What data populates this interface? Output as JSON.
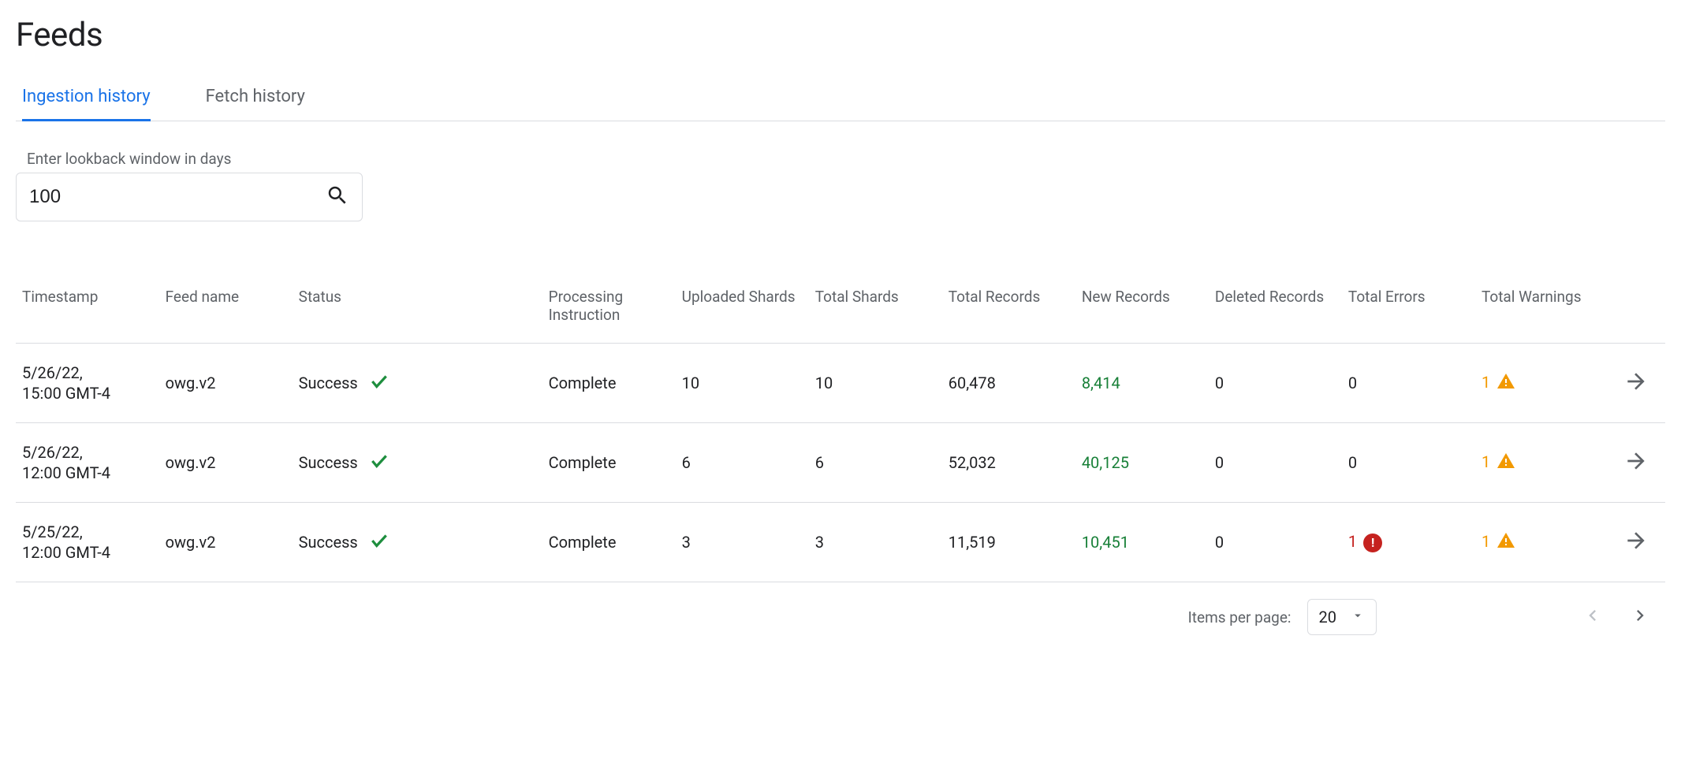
{
  "page_title": "Feeds",
  "tabs": [
    {
      "label": "Ingestion history",
      "active": true
    },
    {
      "label": "Fetch history",
      "active": false
    }
  ],
  "filter": {
    "label": "Enter lookback window in days",
    "value": "100"
  },
  "columns": {
    "timestamp": "Timestamp",
    "feed_name": "Feed name",
    "status": "Status",
    "processing_instruction": "Processing Instruction",
    "uploaded_shards": "Uploaded Shards",
    "total_shards": "Total Shards",
    "total_records": "Total Records",
    "new_records": "New Records",
    "deleted_records": "Deleted Records",
    "total_errors": "Total Errors",
    "total_warnings": "Total Warnings"
  },
  "rows": [
    {
      "timestamp_line1": "5/26/22,",
      "timestamp_line2": "15:00 GMT-4",
      "feed_name": "owg.v2",
      "status": "Success",
      "processing_instruction": "Complete",
      "uploaded_shards": "10",
      "total_shards": "10",
      "total_records": "60,478",
      "new_records": "8,414",
      "deleted_records": "0",
      "total_errors": "0",
      "total_errors_flag": false,
      "total_warnings": "1",
      "total_warnings_flag": true
    },
    {
      "timestamp_line1": "5/26/22,",
      "timestamp_line2": "12:00 GMT-4",
      "feed_name": "owg.v2",
      "status": "Success",
      "processing_instruction": "Complete",
      "uploaded_shards": "6",
      "total_shards": "6",
      "total_records": "52,032",
      "new_records": "40,125",
      "deleted_records": "0",
      "total_errors": "0",
      "total_errors_flag": false,
      "total_warnings": "1",
      "total_warnings_flag": true
    },
    {
      "timestamp_line1": "5/25/22,",
      "timestamp_line2": "12:00 GMT-4",
      "feed_name": "owg.v2",
      "status": "Success",
      "processing_instruction": "Complete",
      "uploaded_shards": "3",
      "total_shards": "3",
      "total_records": "11,519",
      "new_records": "10,451",
      "deleted_records": "0",
      "total_errors": "1",
      "total_errors_flag": true,
      "total_warnings": "1",
      "total_warnings_flag": true
    }
  ],
  "pagination": {
    "items_label": "Items per page:",
    "items_value": "20"
  }
}
